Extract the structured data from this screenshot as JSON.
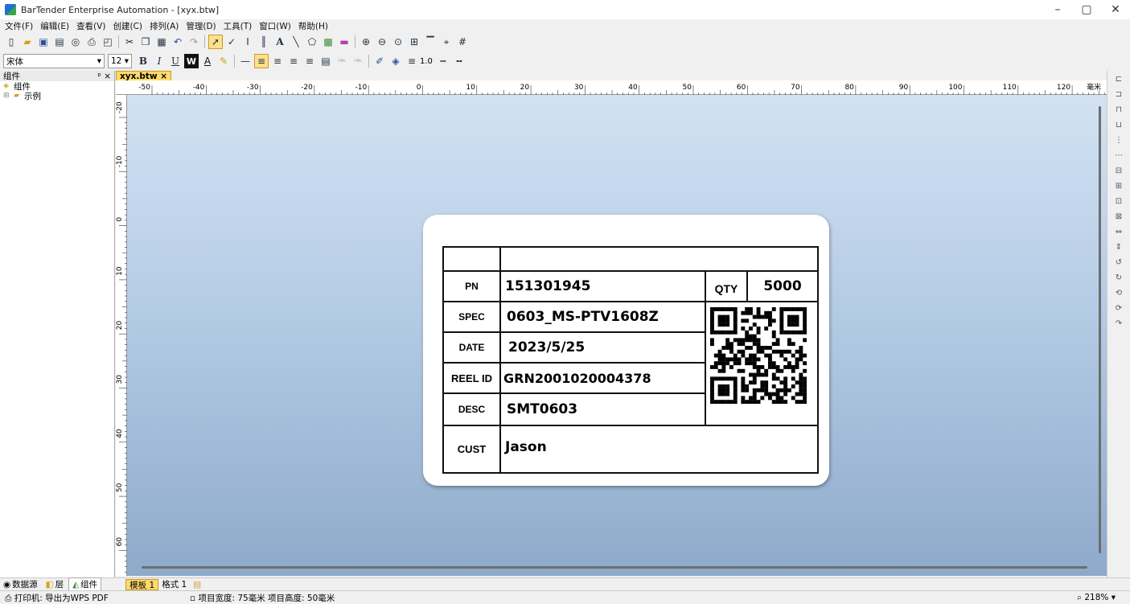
{
  "window": {
    "title": "BarTender Enterprise Automation - [xyx.btw]",
    "controls": [
      "–",
      "▢",
      "✕"
    ]
  },
  "menu": [
    "文件(F)",
    "编辑(E)",
    "查看(V)",
    "创建(C)",
    "排列(A)",
    "管理(D)",
    "工具(T)",
    "窗口(W)",
    "帮助(H)"
  ],
  "toolbar2": {
    "font_name": "宋体",
    "font_size": "12",
    "bold": "B",
    "italic": "I",
    "underline": "U",
    "wbox": "W",
    "line_width": "1.0"
  },
  "left_panel": {
    "title": "组件",
    "pin": "ᵖ ×",
    "items": [
      "组件",
      "示例"
    ]
  },
  "doc_tab": "xyx.btw ×",
  "ruler": {
    "h_labels": [
      "-50",
      "-40",
      "-30",
      "-20",
      "-10",
      "0",
      "10",
      "20",
      "30",
      "40",
      "50",
      "60",
      "70",
      "80",
      "90",
      "100",
      "110",
      "120"
    ],
    "unit": "毫米",
    "v_labels": [
      "-20",
      "-10",
      "0",
      "10",
      "20",
      "30",
      "40",
      "50",
      "60"
    ]
  },
  "label": {
    "rows": [
      {
        "key": "PN",
        "value": "151301945"
      },
      {
        "key": "SPEC",
        "value": "0603_MS-PTV1608Z"
      },
      {
        "key": "DATE",
        "value": "2023/5/25"
      },
      {
        "key": "REEL ID",
        "value": "GRN2001020004378"
      },
      {
        "key": "DESC",
        "value": "SMT0603"
      },
      {
        "key": "CUST",
        "value": "Jason"
      }
    ],
    "qty_key": "QTY",
    "qty_value": "5000"
  },
  "bottom_tabs": {
    "panels": [
      "数据源",
      "层",
      "组件"
    ],
    "pages": [
      "模板 1",
      "格式 1"
    ]
  },
  "status": {
    "printer": "打印机: 导出为WPS PDF",
    "dimensions": "项目宽度: 75毫米  项目高度: 50毫米",
    "zoom": "218%"
  }
}
